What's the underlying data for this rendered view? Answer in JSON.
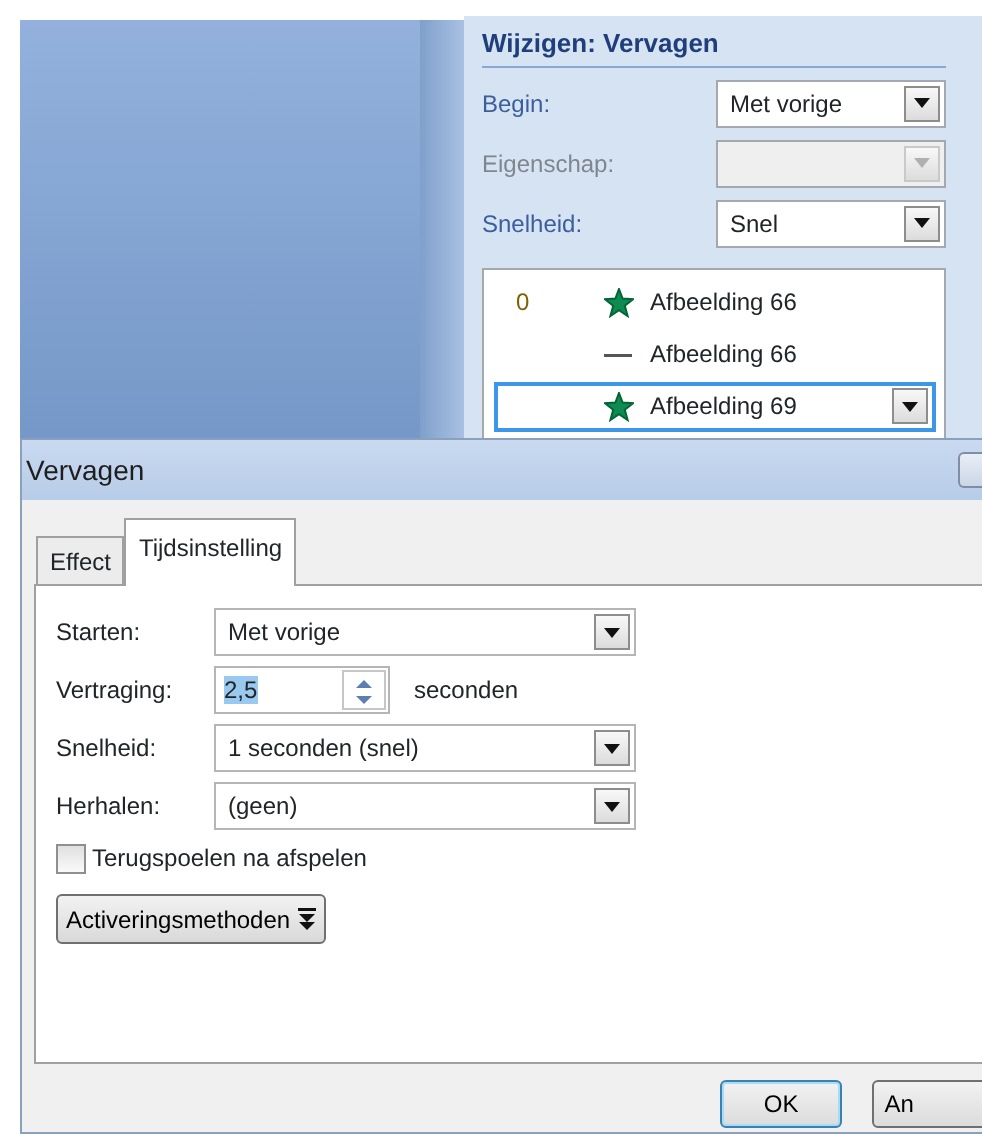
{
  "task_pane": {
    "title": "Wijzigen: Vervagen",
    "fields": [
      {
        "label": "Begin:",
        "value": "Met vorige",
        "disabled": false
      },
      {
        "label": "Eigenschap:",
        "disabled": true
      },
      {
        "label": "Snelheid:",
        "value": "Snel",
        "disabled": false
      }
    ],
    "animation_list": [
      {
        "order": "0",
        "kind": "star",
        "label": "Afbeelding 66",
        "selected": false
      },
      {
        "kind": "line",
        "label": "Afbeelding 66",
        "selected": false
      },
      {
        "kind": "star",
        "label": "Afbeelding 69",
        "selected": true
      }
    ]
  },
  "dialog": {
    "title": "Vervagen",
    "tabs": [
      {
        "label": "Effect",
        "selected": false
      },
      {
        "label": "Tijdsinstelling",
        "selected": true
      }
    ],
    "fields": [
      {
        "kind": "select",
        "label": "Starten:",
        "value": "Met vorige"
      },
      {
        "kind": "spinner",
        "label": "Vertraging:",
        "value": "2,5",
        "unit": "seconden",
        "text_selected": true
      },
      {
        "kind": "select",
        "label": "Snelheid:",
        "value": "1 seconden (snel)"
      },
      {
        "kind": "select",
        "label": "Herhalen:",
        "value": "(geen)"
      }
    ],
    "checkbox": {
      "label": "Terugspoelen na afspelen",
      "checked": false
    },
    "expand_button": "Activeringsmethoden",
    "buttons": [
      {
        "label": "OK",
        "default": true
      },
      {
        "label": "An",
        "default": false
      }
    ]
  }
}
